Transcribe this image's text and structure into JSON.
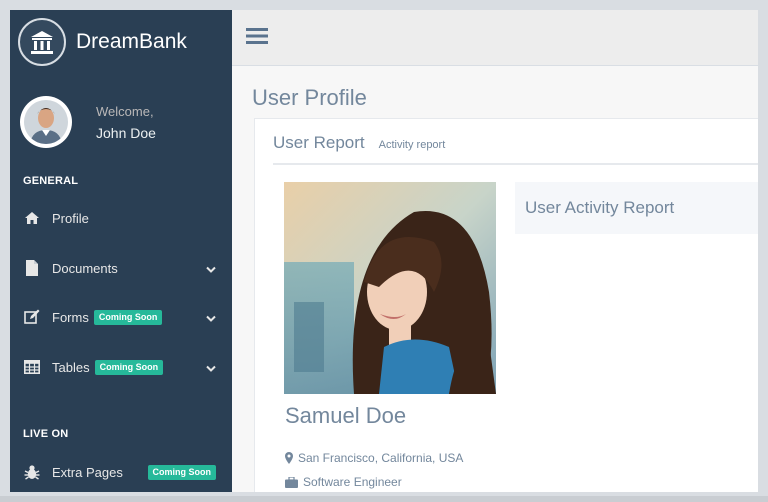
{
  "brand": {
    "name": "DreamBank"
  },
  "profile": {
    "welcome": "Welcome,",
    "name": "John Doe"
  },
  "sidebar": {
    "general_title": "GENERAL",
    "live_title": "LIVE ON",
    "items": [
      {
        "label": "Profile",
        "icon": "home-icon"
      },
      {
        "label": "Documents",
        "icon": "file-icon",
        "chevron": true
      },
      {
        "label": "Forms",
        "icon": "edit-icon",
        "badge": "Coming Soon",
        "chevron": true
      },
      {
        "label": "Tables",
        "icon": "table-icon",
        "badge": "Coming Soon",
        "chevron": true
      }
    ],
    "live_items": [
      {
        "label": "Extra Pages",
        "icon": "bug-icon",
        "badge": "Coming Soon"
      }
    ]
  },
  "page": {
    "title": "User Profile"
  },
  "panel": {
    "title": "User Report",
    "subtitle": "Activity report",
    "user_name": "Samuel Doe",
    "location": "San Francisco, California, USA",
    "job": "Software Engineer",
    "activity_title": "User Activity Report"
  },
  "colors": {
    "sidebar": "#2a3f54",
    "badge": "#26b99a",
    "text_muted": "#73879c"
  }
}
